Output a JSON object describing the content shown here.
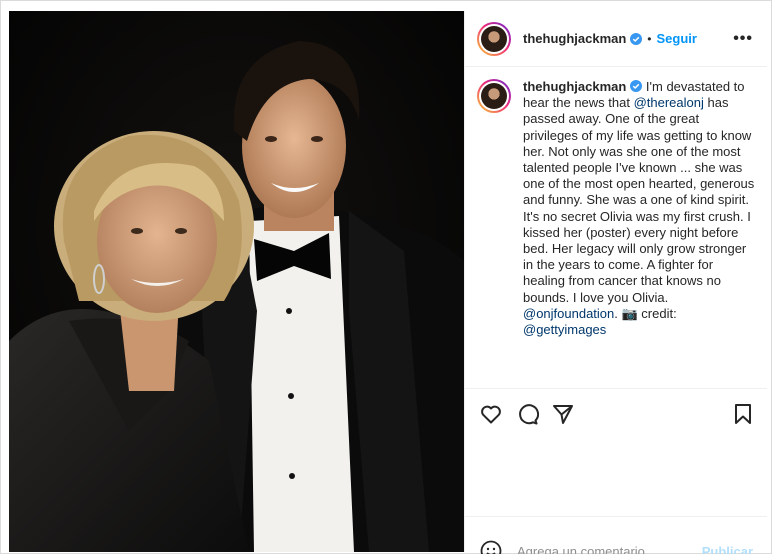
{
  "post": {
    "username": "thehughjackman",
    "follow_label": "Seguir",
    "separator": "•",
    "more_label": "•••"
  },
  "caption": {
    "part1": "I'm devastated to hear the news that ",
    "mention1": "@therealonj",
    "part2": " has passed away. One of the great privileges of my life was getting to know her. Not only was she one of the most talented people I've known ... she was one of the most open hearted, generous and funny. She was a one of kind spirit. It's no secret Olivia was my first crush. I kissed her (poster) every night before bed. Her legacy will only grow stronger in the years to come. A fighter for healing from cancer that knows no bounds. I love you Olivia. ",
    "mention2": "@onjfoundation",
    "part3": ". 📷 credit: ",
    "mention3": "@gettyimages"
  },
  "actions": {
    "like_icon": "heart-icon",
    "comment_icon": "comment-icon",
    "share_icon": "send-icon",
    "save_icon": "bookmark-icon"
  },
  "comment": {
    "placeholder": "Agrega un comentario...",
    "publish_label": "Publicar",
    "emoji_icon": "smiley-icon"
  },
  "colors": {
    "accent": "#0095f6",
    "mention": "#00376b",
    "publish_disabled": "#b2dffc",
    "verified": "#3897f0"
  }
}
